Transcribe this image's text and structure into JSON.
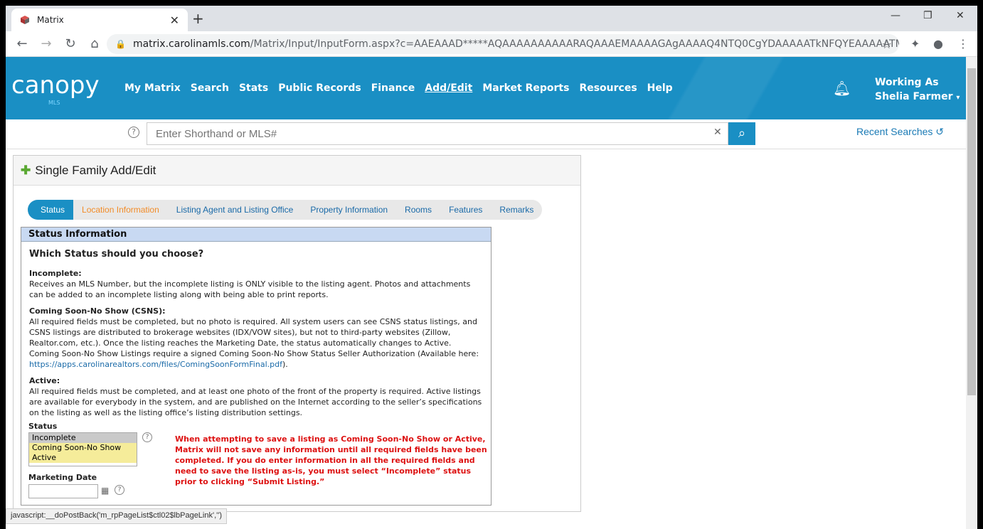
{
  "browser": {
    "tab_title": "Matrix",
    "tab_close": "✕",
    "new_tab": "+",
    "url_host": "matrix.carolinamls.com",
    "url_path": "/Matrix/Input/InputForm.aspx?c=AAEAAAD*****AQAAAAAAAAAARAQAAAEMAAAAGAgAAAAQ4NTQ0CgYDAAAAATkNFQYEAAAAATMNAgYFAAA..."
  },
  "header": {
    "logo": "canopy",
    "logo_sub": "MLS",
    "nav": [
      "My Matrix",
      "Search",
      "Stats",
      "Public Records",
      "Finance",
      "Add/Edit",
      "Market Reports",
      "Resources",
      "Help"
    ],
    "working_as_label": "Working As",
    "user_name": "Shelia Farmer"
  },
  "search": {
    "placeholder": "Enter Shorthand or MLS#",
    "recent_label": "Recent Searches"
  },
  "panel": {
    "title": "Single Family Add/Edit",
    "steps": [
      "Status",
      "Location Information",
      "Listing Agent and Listing Office",
      "Property Information",
      "Rooms",
      "Features",
      "Remarks"
    ]
  },
  "status_box": {
    "header": "Status Information",
    "heading": "Which Status should you choose?",
    "incomplete_title": "Incomplete:",
    "incomplete_text": "Receives an MLS Number, but the incomplete listing is ONLY visible to the listing agent. Photos and attachments can be added to an incomplete listing along with being able to print reports.",
    "csns_title": "Coming Soon-No Show (CSNS):",
    "csns_text": "All required fields must be completed, but no photo is required. All system users can see CSNS status listings, and CSNS listings are distributed to brokerage websites (IDX/VOW sites), but not to third-party websites (Zillow, Realtor.com, etc.). Once the listing reaches the Marketing Date, the status automatically changes to Active. Coming Soon-No Show Listings require a signed Coming Soon-No Show Status Seller Authorization (Available here:",
    "csns_link": "https://apps.carolinarealtors.com/files/ComingSoonFormFinal.pdf",
    "csns_after": ").",
    "active_title": "Active:",
    "active_text": "All required fields must be completed, and at least one photo of the front of the property is required. Active listings are available for everybody in the system, and are published on the Internet according to the seller’s specifications on the listing as well as the listing office’s listing distribution settings.",
    "status_label": "Status",
    "status_options": [
      "Incomplete",
      "Coming Soon-No Show",
      "Active"
    ],
    "marketing_label": "Marketing Date",
    "warning": "When attempting to save a listing as Coming Soon-No Show or Active, Matrix will not save any information until all required fields have been completed. If you do enter information in all the required fields and need to save the listing as-is, you must select “Incomplete” status prior to clicking “Submit Listing.”"
  },
  "statusbar": "javascript:__doPostBack('m_rpPageList$ctl02$lbPageLink','')"
}
